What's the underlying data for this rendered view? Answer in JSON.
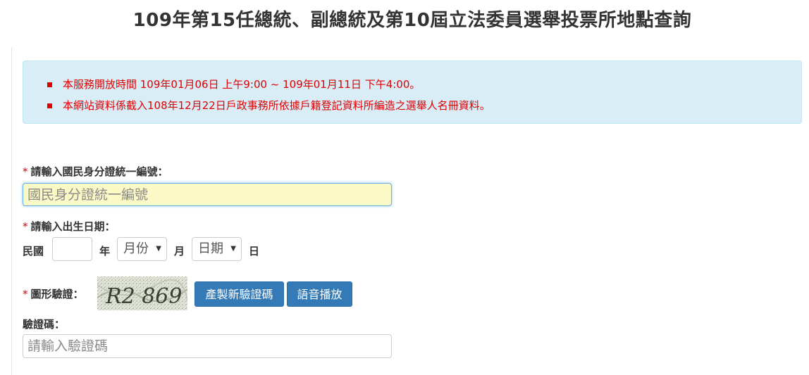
{
  "title": "109年第15任總統、副總統及第10屆立法委員選舉投票所地點查詢",
  "notices": [
    "本服務開放時間 109年01月06日 上午9:00 ~ 109年01月11日 下午4:00。",
    "本網站資料係截入108年12月22日戶政事務所依據戶籍登記資料所編造之選舉人名冊資料。"
  ],
  "form": {
    "required_mark": "*",
    "id_label": "請輸入國民身分證統一編號：",
    "id_placeholder": "國民身分證統一編號",
    "birth_label": "請輸入出生日期：",
    "roc_label": "民國",
    "year_unit": "年",
    "month_select": "月份",
    "month_unit": "月",
    "day_select": "日期",
    "day_unit": "日",
    "captcha_label": "圖形驗證：",
    "captcha_text": "R2 869",
    "refresh_button": "產製新驗證碼",
    "audio_button": "語音播放",
    "code_label": "驗證碼：",
    "code_placeholder": "請輸入驗證碼",
    "select_caret": "▼"
  }
}
